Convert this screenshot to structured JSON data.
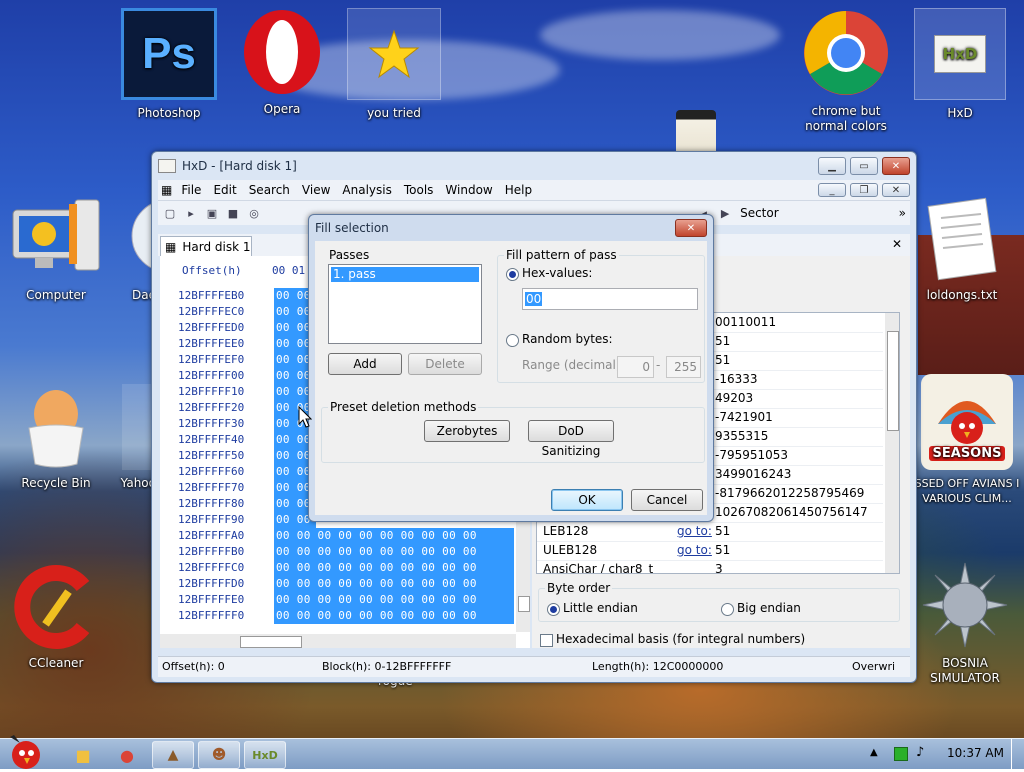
{
  "desktop_icons": [
    {
      "label": "Photoshop"
    },
    {
      "label": "Opera"
    },
    {
      "label": "you tried"
    },
    {
      "label": "chrome but normal colors"
    },
    {
      "label": "HxD"
    },
    {
      "label": "Computer"
    },
    {
      "label": "Dae"
    },
    {
      "label": "loldongs.txt"
    },
    {
      "label": "Recycle Bin"
    },
    {
      "label": "Yahoo"
    },
    {
      "label": "SSED OFF AVIANS I VARIOUS CLIM..."
    },
    {
      "label": "CCleaner"
    },
    {
      "label": "BOSNIA SIMULATOR"
    }
  ],
  "ps_glyph": "Ps",
  "seasons_glyph": "SEASONS",
  "hxd_glyph": "HxD",
  "hxd": {
    "title": "HxD - [Hard disk 1]",
    "menu": [
      "File",
      "Edit",
      "Search",
      "View",
      "Analysis",
      "Tools",
      "Window",
      "Help"
    ],
    "toolbar_sector": "Sector",
    "tab": "Hard disk 1",
    "offset_header": "Offset(h)",
    "col_header": "00 01",
    "hex_rows": [
      {
        "offset": "12BFFFFEB0",
        "bytes": "00 00"
      },
      {
        "offset": "12BFFFFEC0",
        "bytes": "00 00"
      },
      {
        "offset": "12BFFFFED0",
        "bytes": "00 00"
      },
      {
        "offset": "12BFFFFEE0",
        "bytes": "00 00"
      },
      {
        "offset": "12BFFFFEF0",
        "bytes": "00 00"
      },
      {
        "offset": "12BFFFFF00",
        "bytes": "00 00"
      },
      {
        "offset": "12BFFFFF10",
        "bytes": "00 00"
      },
      {
        "offset": "12BFFFFF20",
        "bytes": "00 00"
      },
      {
        "offset": "12BFFFFF30",
        "bytes": "00 00"
      },
      {
        "offset": "12BFFFFF40",
        "bytes": "00 00"
      },
      {
        "offset": "12BFFFFF50",
        "bytes": "00 00"
      },
      {
        "offset": "12BFFFFF60",
        "bytes": "00 00"
      },
      {
        "offset": "12BFFFFF70",
        "bytes": "00 00"
      },
      {
        "offset": "12BFFFFF80",
        "bytes": "00 00"
      },
      {
        "offset": "12BFFFFF90",
        "bytes": "00 00"
      },
      {
        "offset": "12BFFFFFA0",
        "bytes": "00 00 00 00 00 00 00 00 00 00"
      },
      {
        "offset": "12BFFFFFB0",
        "bytes": "00 00 00 00 00 00 00 00 00 00"
      },
      {
        "offset": "12BFFFFFC0",
        "bytes": "00 00 00 00 00 00 00 00 00 00"
      },
      {
        "offset": "12BFFFFFD0",
        "bytes": "00 00 00 00 00 00 00 00 00 00"
      },
      {
        "offset": "12BFFFFFE0",
        "bytes": "00 00 00 00 00 00 00 00 00 00"
      },
      {
        "offset": "12BFFFFFF0",
        "bytes": "00 00 00 00 00 00 00 00 00 00"
      }
    ],
    "inspector_rows": [
      {
        "name": "",
        "goto": "",
        "value": "00110011"
      },
      {
        "name": "",
        "goto": "",
        "value": "51"
      },
      {
        "name": "",
        "goto": "",
        "value": "51"
      },
      {
        "name": "",
        "goto": "",
        "value": "-16333"
      },
      {
        "name": "",
        "goto": "",
        "value": "49203"
      },
      {
        "name": "",
        "goto": "",
        "value": "-7421901"
      },
      {
        "name": "",
        "goto": "",
        "value": "9355315"
      },
      {
        "name": "",
        "goto": "",
        "value": "-795951053"
      },
      {
        "name": "",
        "goto": "",
        "value": "3499016243"
      },
      {
        "name": "",
        "goto": "",
        "value": "-8179662012258795469"
      },
      {
        "name": "",
        "goto": "",
        "value": "10267082061450756147"
      },
      {
        "name": "LEB128",
        "goto": "go to:",
        "value": "51"
      },
      {
        "name": "ULEB128",
        "goto": "go to:",
        "value": "51"
      },
      {
        "name": "AnsiChar / char8_t",
        "goto": "",
        "value": "3"
      }
    ],
    "byte_order_label": "Byte order",
    "little_endian": "Little endian",
    "big_endian": "Big endian",
    "hex_basis": "Hexadecimal basis (for integral numbers)",
    "status_offset": "Offset(h): 0",
    "status_block": "Block(h): 0-12BFFFFFFF",
    "status_length": "Length(h): 12C0000000",
    "status_mode": "Overwri"
  },
  "dialog": {
    "title": "Fill selection",
    "passes_label": "Passes",
    "pass_item": "1. pass",
    "add": "Add",
    "delete": "Delete",
    "fill_pattern_label": "Fill pattern of pass",
    "hex_values_label": "Hex-values:",
    "hex_value": "00",
    "random_bytes_label": "Random bytes:",
    "range_label": "Range (decimal):",
    "range_from": "0",
    "range_sep": "-",
    "range_to": "255",
    "preset_label": "Preset deletion methods",
    "zerobytes": "Zerobytes",
    "dod": "DoD Sanitizing",
    "ok": "OK",
    "cancel": "Cancel"
  },
  "taskbar": {
    "clock": "10:37 AM"
  },
  "bg_text": "rogue"
}
